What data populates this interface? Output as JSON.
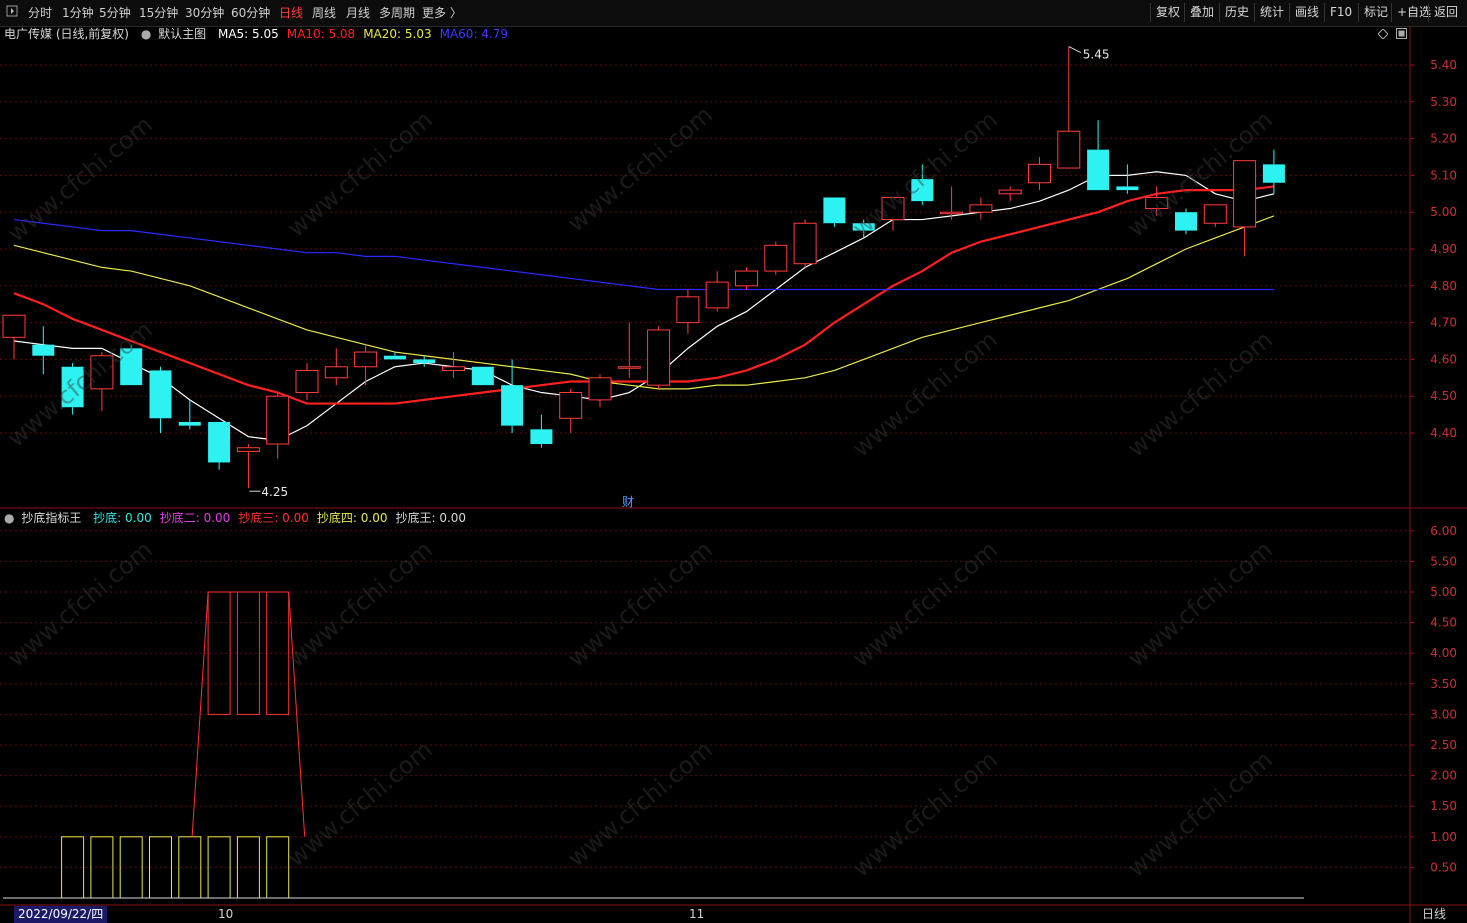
{
  "toolbar": {
    "menu_icon": "menu-icon",
    "periods": [
      "分时",
      "1分钟",
      "5分钟",
      "15分钟",
      "30分钟",
      "60分钟",
      "日线",
      "周线",
      "月线",
      "多周期",
      "更多 〉"
    ],
    "active_period": "日线",
    "right": [
      "复权",
      "叠加",
      "历史",
      "统计",
      "画线",
      "F10",
      "标记",
      "+自选",
      "返回"
    ]
  },
  "main_panel": {
    "stock": "电广传媒 (日线,前复权)",
    "template": "默认主图",
    "ma": [
      {
        "label": "MA5: 5.05",
        "color": "#ffffff"
      },
      {
        "label": "MA10: 5.08",
        "color": "#ff2020"
      },
      {
        "label": "MA20: 5.03",
        "color": "#e8e84a"
      },
      {
        "label": "MA60: 4.79",
        "color": "#2a2aff"
      }
    ],
    "high_label": "5.45",
    "low_label": "4.25",
    "marker_label": "财"
  },
  "indicator_panel": {
    "name": "抄底指标王",
    "lines": [
      {
        "label": "抄底: 0.00",
        "color": "#33e6e6"
      },
      {
        "label": "抄底二: 0.00",
        "color": "#e040e0"
      },
      {
        "label": "抄底三: 0.00",
        "color": "#ff3030"
      },
      {
        "label": "抄底四: 0.00",
        "color": "#e8e84a"
      },
      {
        "label": "抄底王: 0.00",
        "color": "#d8d8d8"
      }
    ]
  },
  "bottom_axis": {
    "date_label": "2022/09/22/四",
    "month_labels": [
      "10",
      "11"
    ],
    "period_label": "日线"
  },
  "watermark": "www.cfchi.com",
  "chart_data": [
    {
      "type": "candlestick",
      "title": "电广传媒 (日线,前复权)",
      "ylim": [
        4.28,
        5.49
      ],
      "y_ticks": [
        "5.40",
        "5.30",
        "5.20",
        "5.10",
        "5.00",
        "4.90",
        "4.80",
        "4.70",
        "4.60",
        "4.50",
        "4.40"
      ],
      "candles": [
        {
          "o": 4.66,
          "h": 4.67,
          "l": 4.6,
          "c": 4.72
        },
        {
          "o": 4.64,
          "h": 4.69,
          "l": 4.56,
          "c": 4.61
        },
        {
          "o": 4.58,
          "h": 4.59,
          "l": 4.45,
          "c": 4.47
        },
        {
          "o": 4.52,
          "h": 4.62,
          "l": 4.46,
          "c": 4.61
        },
        {
          "o": 4.63,
          "h": 4.64,
          "l": 4.53,
          "c": 4.53
        },
        {
          "o": 4.57,
          "h": 4.58,
          "l": 4.4,
          "c": 4.44
        },
        {
          "o": 4.43,
          "h": 4.49,
          "l": 4.41,
          "c": 4.42
        },
        {
          "o": 4.43,
          "h": 4.43,
          "l": 4.3,
          "c": 4.32
        },
        {
          "o": 4.35,
          "h": 4.37,
          "l": 4.25,
          "c": 4.36
        },
        {
          "o": 4.37,
          "h": 4.51,
          "l": 4.33,
          "c": 4.5
        },
        {
          "o": 4.51,
          "h": 4.59,
          "l": 4.49,
          "c": 4.57
        },
        {
          "o": 4.55,
          "h": 4.63,
          "l": 4.53,
          "c": 4.58
        },
        {
          "o": 4.58,
          "h": 4.64,
          "l": 4.53,
          "c": 4.62
        },
        {
          "o": 4.61,
          "h": 4.62,
          "l": 4.6,
          "c": 4.6
        },
        {
          "o": 4.6,
          "h": 4.61,
          "l": 4.58,
          "c": 4.59
        },
        {
          "o": 4.57,
          "h": 4.62,
          "l": 4.55,
          "c": 4.58
        },
        {
          "o": 4.58,
          "h": 4.58,
          "l": 4.53,
          "c": 4.53
        },
        {
          "o": 4.53,
          "h": 4.6,
          "l": 4.4,
          "c": 4.42
        },
        {
          "o": 4.41,
          "h": 4.45,
          "l": 4.36,
          "c": 4.37
        },
        {
          "o": 4.44,
          "h": 4.52,
          "l": 4.4,
          "c": 4.51
        },
        {
          "o": 4.49,
          "h": 4.56,
          "l": 4.47,
          "c": 4.55
        },
        {
          "o": 4.58,
          "h": 4.7,
          "l": 4.55,
          "c": 4.58
        },
        {
          "o": 4.53,
          "h": 4.69,
          "l": 4.52,
          "c": 4.68
        },
        {
          "o": 4.7,
          "h": 4.79,
          "l": 4.67,
          "c": 4.77
        },
        {
          "o": 4.74,
          "h": 4.84,
          "l": 4.73,
          "c": 4.81
        },
        {
          "o": 4.8,
          "h": 4.85,
          "l": 4.79,
          "c": 4.84
        },
        {
          "o": 4.84,
          "h": 4.92,
          "l": 4.83,
          "c": 4.91
        },
        {
          "o": 4.86,
          "h": 4.98,
          "l": 4.85,
          "c": 4.97
        },
        {
          "o": 5.04,
          "h": 5.04,
          "l": 4.96,
          "c": 4.97
        },
        {
          "o": 4.97,
          "h": 4.98,
          "l": 4.93,
          "c": 4.95
        },
        {
          "o": 4.98,
          "h": 5.04,
          "l": 4.95,
          "c": 5.04
        },
        {
          "o": 5.09,
          "h": 5.13,
          "l": 5.02,
          "c": 5.03
        },
        {
          "o": 5.0,
          "h": 5.07,
          "l": 4.98,
          "c": 5.0
        },
        {
          "o": 5.0,
          "h": 5.04,
          "l": 4.98,
          "c": 5.02
        },
        {
          "o": 5.05,
          "h": 5.07,
          "l": 5.03,
          "c": 5.06
        },
        {
          "o": 5.08,
          "h": 5.15,
          "l": 5.06,
          "c": 5.13
        },
        {
          "o": 5.12,
          "h": 5.45,
          "l": 5.12,
          "c": 5.22
        },
        {
          "o": 5.17,
          "h": 5.25,
          "l": 5.06,
          "c": 5.06
        },
        {
          "o": 5.07,
          "h": 5.13,
          "l": 5.05,
          "c": 5.06
        },
        {
          "o": 5.01,
          "h": 5.07,
          "l": 4.99,
          "c": 5.04
        },
        {
          "o": 5.0,
          "h": 5.01,
          "l": 4.94,
          "c": 4.95
        },
        {
          "o": 4.97,
          "h": 5.0,
          "l": 4.96,
          "c": 5.02
        },
        {
          "o": 4.96,
          "h": 5.05,
          "l": 4.88,
          "c": 5.14
        },
        {
          "o": 5.13,
          "h": 5.17,
          "l": 5.05,
          "c": 5.08
        }
      ],
      "series": [
        {
          "name": "MA5",
          "color": "#ffffff",
          "values": [
            4.65,
            4.64,
            4.63,
            4.63,
            4.59,
            4.55,
            4.49,
            4.44,
            4.39,
            4.38,
            4.42,
            4.48,
            4.54,
            4.58,
            4.59,
            4.58,
            4.57,
            4.53,
            4.51,
            4.5,
            4.49,
            4.51,
            4.56,
            4.63,
            4.69,
            4.73,
            4.79,
            4.85,
            4.89,
            4.93,
            4.98,
            4.98,
            4.99,
            5.0,
            5.01,
            5.03,
            5.06,
            5.1,
            5.1,
            5.11,
            5.1,
            5.05,
            5.03,
            5.05
          ]
        },
        {
          "name": "MA10",
          "color": "#ff2020",
          "values": [
            4.78,
            4.75,
            4.71,
            4.68,
            4.65,
            4.62,
            4.59,
            4.56,
            4.53,
            4.51,
            4.48,
            4.48,
            4.48,
            4.48,
            4.49,
            4.5,
            4.51,
            4.52,
            4.53,
            4.54,
            4.54,
            4.54,
            4.54,
            4.54,
            4.55,
            4.57,
            4.6,
            4.64,
            4.7,
            4.75,
            4.8,
            4.84,
            4.89,
            4.92,
            4.94,
            4.96,
            4.98,
            5.0,
            5.03,
            5.05,
            5.06,
            5.06,
            5.06,
            5.07
          ]
        },
        {
          "name": "MA20",
          "color": "#e8e84a",
          "values": [
            4.91,
            4.89,
            4.87,
            4.85,
            4.84,
            4.82,
            4.8,
            4.77,
            4.74,
            4.71,
            4.68,
            4.66,
            4.64,
            4.62,
            4.61,
            4.6,
            4.59,
            4.58,
            4.57,
            4.56,
            4.54,
            4.53,
            4.52,
            4.52,
            4.53,
            4.53,
            4.54,
            4.55,
            4.57,
            4.6,
            4.63,
            4.66,
            4.68,
            4.7,
            4.72,
            4.74,
            4.76,
            4.79,
            4.82,
            4.86,
            4.9,
            4.93,
            4.96,
            4.99
          ]
        },
        {
          "name": "MA60",
          "color": "#2a2aff",
          "values": [
            4.98,
            4.97,
            4.96,
            4.95,
            4.95,
            4.94,
            4.93,
            4.92,
            4.91,
            4.9,
            4.89,
            4.89,
            4.88,
            4.88,
            4.87,
            4.86,
            4.85,
            4.84,
            4.83,
            4.82,
            4.81,
            4.8,
            4.79,
            4.79,
            4.79,
            4.79,
            4.79,
            4.79,
            4.79,
            4.79,
            4.79,
            4.79,
            4.79,
            4.79,
            4.79,
            4.79,
            4.79,
            4.79,
            4.79,
            4.79,
            4.79,
            4.79,
            4.79,
            4.79
          ]
        }
      ]
    },
    {
      "type": "bar",
      "title": "抄底指标王",
      "ylim": [
        0,
        6.4
      ],
      "y_ticks": [
        "6.00",
        "5.50",
        "5.00",
        "4.50",
        "4.00",
        "3.50",
        "3.00",
        "2.50",
        "2.00",
        "1.50",
        "1.00",
        "0.50"
      ],
      "series": [
        {
          "name": "抄底四",
          "color": "#e8e84a",
          "values": [
            0,
            0,
            1,
            1,
            1,
            1,
            1,
            1,
            1,
            1,
            0,
            0,
            0,
            0,
            0,
            0,
            0,
            0,
            0,
            0,
            0,
            0,
            0,
            0,
            0,
            0,
            0,
            0,
            0,
            0,
            0,
            0,
            0,
            0,
            0,
            0,
            0,
            0,
            0,
            0,
            0,
            0,
            0,
            0
          ]
        },
        {
          "name": "抄底三",
          "color": "#ff3030",
          "values": [
            0,
            0,
            0,
            0,
            0,
            0,
            0,
            5,
            5,
            5,
            0,
            0,
            0,
            0,
            0,
            0,
            0,
            0,
            0,
            0,
            0,
            0,
            0,
            0,
            0,
            0,
            0,
            0,
            0,
            0,
            0,
            0,
            0,
            0,
            0,
            0,
            0,
            0,
            0,
            0,
            0,
            0,
            0,
            0
          ]
        }
      ],
      "inner_level": 3
    }
  ]
}
